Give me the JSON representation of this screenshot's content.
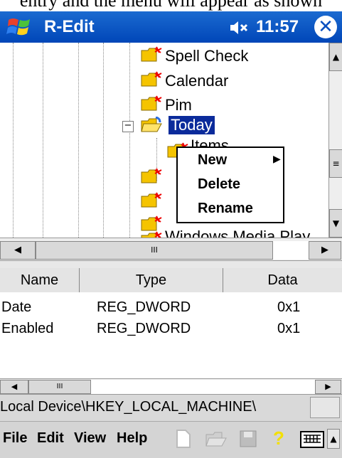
{
  "caption": {
    "text": "entry and the menu will appear as shown"
  },
  "titlebar": {
    "app_title": "R-Edit",
    "time": "11:57"
  },
  "tree": {
    "nodes": [
      {
        "label": "Spell Check"
      },
      {
        "label": "Calendar"
      },
      {
        "label": "Pim"
      },
      {
        "label": "Today",
        "selected": true
      },
      {
        "label": "Items"
      },
      {
        "label": "Windows Media Play"
      }
    ]
  },
  "context_menu": {
    "items": [
      "New",
      "Delete",
      "Rename"
    ]
  },
  "list": {
    "columns": [
      "Name",
      "Type",
      "Data"
    ],
    "rows": [
      {
        "name": "Date",
        "type": "REG_DWORD",
        "data": "0x1"
      },
      {
        "name": "Enabled",
        "type": "REG_DWORD",
        "data": "0x1"
      }
    ]
  },
  "status": {
    "path": "Local Device\\HKEY_LOCAL_MACHINE\\"
  },
  "menubar": {
    "items": [
      "File",
      "Edit",
      "View",
      "Help"
    ]
  },
  "colors": {
    "titlebar": "#0a55c6",
    "selection": "#0b2b9b",
    "folder": "#f5c400"
  },
  "icons": [
    "windows-flag-icon",
    "speaker-icon",
    "close-icon",
    "folder-icon",
    "new-doc-icon",
    "open-icon",
    "save-icon",
    "help-icon",
    "keyboard-icon"
  ]
}
